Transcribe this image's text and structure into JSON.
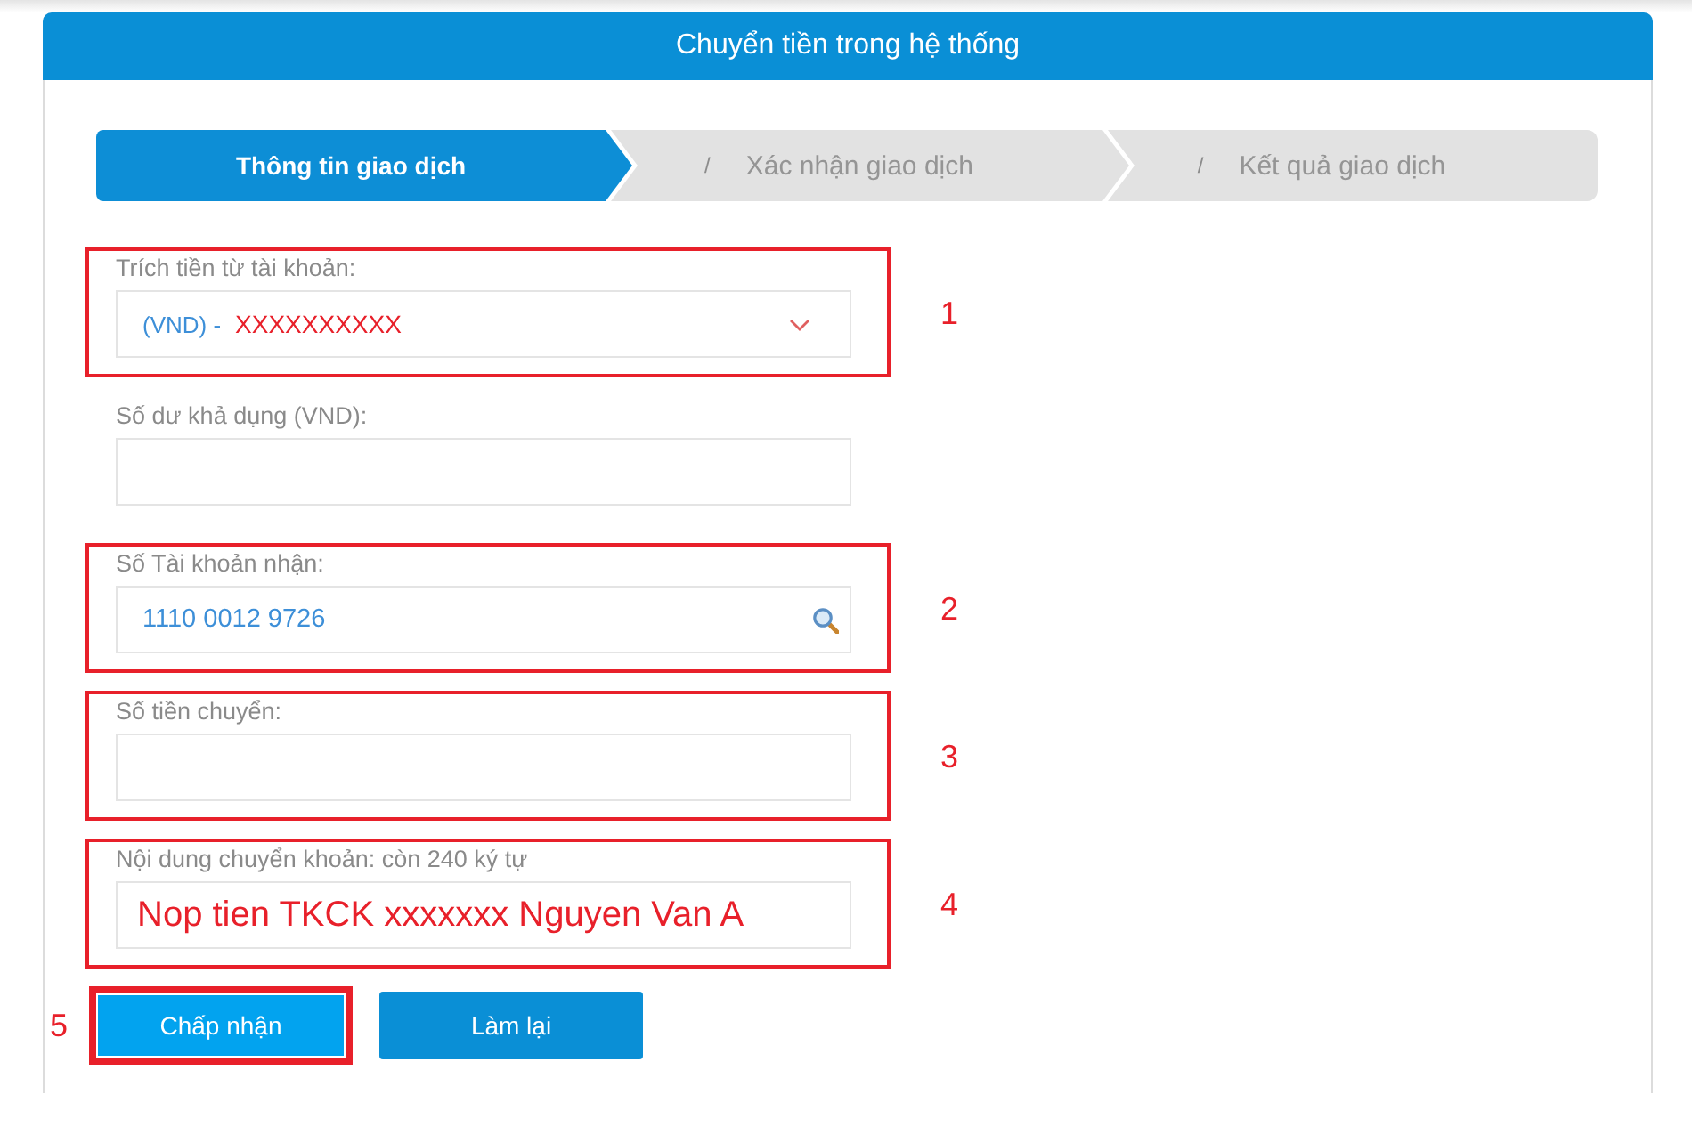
{
  "header": {
    "title": "Chuyển tiền trong hệ thống"
  },
  "steps": [
    {
      "label": "Thông tin giao dịch",
      "selected": true
    },
    {
      "prefix": "/",
      "label": "Xác nhận giao dịch",
      "selected": false
    },
    {
      "prefix": "/",
      "label": "Kết quả giao dịch",
      "selected": false
    }
  ],
  "fields": [
    {
      "kind": "select",
      "label": "Trích tiền từ tài khoản:",
      "value": "(VND) -",
      "overlay": "XXXXXXXXXX",
      "annotation": "1"
    },
    {
      "kind": "text",
      "label": "Số dư khả dụng (VND):"
    },
    {
      "kind": "search",
      "label": "Số Tài khoản nhận:",
      "value": "1110 0012 9726",
      "annotation": "2"
    },
    {
      "kind": "text",
      "label": "Số tiền chuyển:",
      "annotation": "3"
    },
    {
      "kind": "text",
      "label": "Nội dung chuyển khoản: còn 240 ký tự",
      "overlay": "Nop tien TKCK xxxxxxx Nguyen Van A",
      "annotation": "4"
    }
  ],
  "buttons": [
    {
      "label": "Chấp nhận",
      "focused": true,
      "annotation": "5"
    },
    {
      "label": "Làm lại",
      "focused": false
    }
  ]
}
